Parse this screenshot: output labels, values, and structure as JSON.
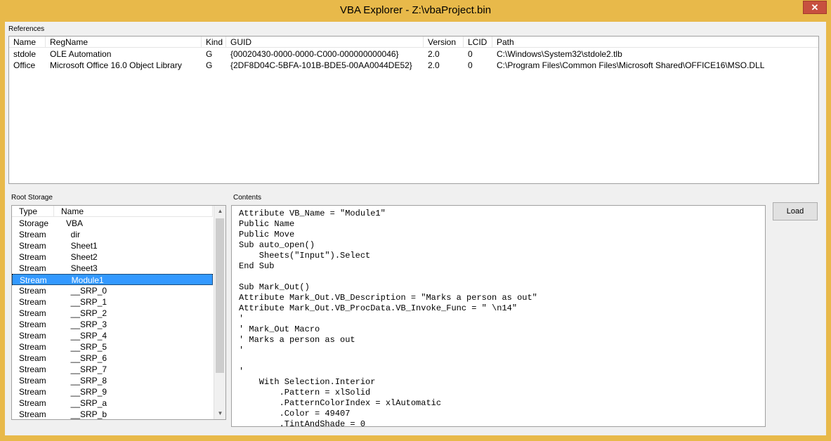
{
  "window": {
    "title": "VBA Explorer - Z:\\vbaProject.bin",
    "close_glyph": "✕"
  },
  "references": {
    "label": "References",
    "columns": [
      "Name",
      "RegName",
      "Kind",
      "GUID",
      "Version",
      "LCID",
      "Path"
    ],
    "rows": [
      {
        "name": "stdole",
        "regname": "OLE Automation",
        "kind": "G",
        "guid": "{00020430-0000-0000-C000-000000000046}",
        "version": "2.0",
        "lcid": "0",
        "path": "C:\\Windows\\System32\\stdole2.tlb"
      },
      {
        "name": "Office",
        "regname": "Microsoft Office 16.0 Object Library",
        "kind": "G",
        "guid": "{2DF8D04C-5BFA-101B-BDE5-00AA0044DE52}",
        "version": "2.0",
        "lcid": "0",
        "path": "C:\\Program Files\\Common Files\\Microsoft Shared\\OFFICE16\\MSO.DLL"
      }
    ]
  },
  "root_storage": {
    "label": "Root Storage",
    "columns": [
      "Type",
      "Name"
    ],
    "rows": [
      {
        "type": "Storage",
        "name": "VBA"
      },
      {
        "type": "Stream",
        "name": "  dir"
      },
      {
        "type": "Stream",
        "name": "  Sheet1"
      },
      {
        "type": "Stream",
        "name": "  Sheet2"
      },
      {
        "type": "Stream",
        "name": "  Sheet3"
      },
      {
        "type": "Stream",
        "name": "  Module1"
      },
      {
        "type": "Stream",
        "name": "  __SRP_0"
      },
      {
        "type": "Stream",
        "name": "  __SRP_1"
      },
      {
        "type": "Stream",
        "name": "  __SRP_2"
      },
      {
        "type": "Stream",
        "name": "  __SRP_3"
      },
      {
        "type": "Stream",
        "name": "  __SRP_4"
      },
      {
        "type": "Stream",
        "name": "  __SRP_5"
      },
      {
        "type": "Stream",
        "name": "  __SRP_6"
      },
      {
        "type": "Stream",
        "name": "  __SRP_7"
      },
      {
        "type": "Stream",
        "name": "  __SRP_8"
      },
      {
        "type": "Stream",
        "name": "  __SRP_9"
      },
      {
        "type": "Stream",
        "name": "  __SRP_a"
      },
      {
        "type": "Stream",
        "name": "  __SRP_b"
      }
    ],
    "selected_index": 5
  },
  "contents": {
    "label": "Contents",
    "lines": [
      "Attribute VB_Name = \"Module1\"",
      "Public Name",
      "Public Move",
      "Sub auto_open()",
      "    Sheets(\"Input\").Select",
      "End Sub",
      "",
      "Sub Mark_Out()",
      "Attribute Mark_Out.VB_Description = \"Marks a person as out\"",
      "Attribute Mark_Out.VB_ProcData.VB_Invoke_Func = \" \\n14\"",
      "'",
      "' Mark_Out Macro",
      "' Marks a person as out",
      "'",
      "",
      "'",
      "    With Selection.Interior",
      "        .Pattern = xlSolid",
      "        .PatternColorIndex = xlAutomatic",
      "        .Color = 49407",
      "        .TintAndShade = 0"
    ]
  },
  "buttons": {
    "load": "Load"
  }
}
